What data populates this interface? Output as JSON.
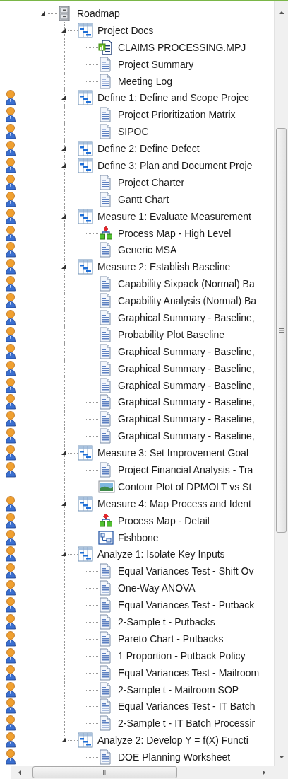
{
  "tree": {
    "label": "Roadmap",
    "kind": "cabinet",
    "assigned": false,
    "expanded": true,
    "children": [
      {
        "label": "Project Docs",
        "kind": "group",
        "assigned": false,
        "expanded": true,
        "children": [
          {
            "label": "CLAIMS PROCESSING.MPJ",
            "kind": "project",
            "assigned": false
          },
          {
            "label": "Project Summary",
            "kind": "document",
            "assigned": false
          },
          {
            "label": "Meeting Log",
            "kind": "document",
            "assigned": false
          }
        ]
      },
      {
        "label": "Define 1: Define and Scope Projec",
        "kind": "group",
        "assigned": true,
        "expanded": true,
        "children": [
          {
            "label": "Project Prioritization Matrix",
            "kind": "document",
            "assigned": true
          },
          {
            "label": "SIPOC",
            "kind": "document",
            "assigned": true
          }
        ]
      },
      {
        "label": "Define 2: Define Defect",
        "kind": "group",
        "assigned": true,
        "expanded": true
      },
      {
        "label": "Define 3: Plan and Document Proje",
        "kind": "group",
        "assigned": true,
        "expanded": true,
        "children": [
          {
            "label": "Project Charter",
            "kind": "document",
            "assigned": true
          },
          {
            "label": "Gantt Chart",
            "kind": "document",
            "assigned": true
          }
        ]
      },
      {
        "label": "Measure 1: Evaluate Measurement",
        "kind": "group",
        "assigned": true,
        "expanded": true,
        "children": [
          {
            "label": "Process Map - High Level",
            "kind": "process-map",
            "assigned": true
          },
          {
            "label": "Generic MSA",
            "kind": "document",
            "assigned": true
          }
        ]
      },
      {
        "label": "Measure 2: Establish Baseline",
        "kind": "group",
        "assigned": true,
        "expanded": true,
        "children": [
          {
            "label": "Capability Sixpack (Normal) Ba",
            "kind": "document",
            "assigned": true
          },
          {
            "label": "Capability Analysis (Normal) Ba",
            "kind": "document",
            "assigned": true
          },
          {
            "label": "Graphical Summary - Baseline,",
            "kind": "document",
            "assigned": true
          },
          {
            "label": "Probability Plot Baseline",
            "kind": "document",
            "assigned": true
          },
          {
            "label": "Graphical Summary - Baseline,",
            "kind": "document",
            "assigned": true
          },
          {
            "label": "Graphical Summary - Baseline,",
            "kind": "document",
            "assigned": true
          },
          {
            "label": "Graphical Summary - Baseline,",
            "kind": "document",
            "assigned": true
          },
          {
            "label": "Graphical Summary - Baseline,",
            "kind": "document",
            "assigned": true
          },
          {
            "label": "Graphical Summary - Baseline,",
            "kind": "document",
            "assigned": true
          },
          {
            "label": "Graphical Summary - Baseline,",
            "kind": "document",
            "assigned": true
          }
        ]
      },
      {
        "label": "Measure 3: Set Improvement Goal",
        "kind": "group",
        "assigned": true,
        "expanded": true,
        "children": [
          {
            "label": "Project Financial Analysis - Tra",
            "kind": "document",
            "assigned": true
          },
          {
            "label": "Contour Plot of DPMOLT vs St",
            "kind": "graph",
            "assigned": false
          }
        ]
      },
      {
        "label": "Measure 4: Map Process and Ident",
        "kind": "group",
        "assigned": true,
        "expanded": true,
        "children": [
          {
            "label": "Process Map - Detail",
            "kind": "process-map",
            "assigned": true
          },
          {
            "label": "Fishbone",
            "kind": "fishbone",
            "assigned": true
          }
        ]
      },
      {
        "label": "Analyze 1: Isolate Key Inputs",
        "kind": "group",
        "assigned": true,
        "expanded": true,
        "children": [
          {
            "label": "Equal Variances Test - Shift Ov",
            "kind": "document",
            "assigned": true
          },
          {
            "label": "One-Way ANOVA",
            "kind": "document",
            "assigned": true
          },
          {
            "label": "Equal Variances Test - Putback",
            "kind": "document",
            "assigned": true
          },
          {
            "label": "2-Sample t - Putbacks",
            "kind": "document",
            "assigned": true
          },
          {
            "label": "Pareto Chart - Putbacks",
            "kind": "document",
            "assigned": true
          },
          {
            "label": "1 Proportion - Putback Policy",
            "kind": "document",
            "assigned": true
          },
          {
            "label": "Equal Variances Test - Mailroom",
            "kind": "document",
            "assigned": true
          },
          {
            "label": "2-Sample t - Mailroom SOP",
            "kind": "document",
            "assigned": true
          },
          {
            "label": "Equal Variances Test - IT Batch",
            "kind": "document",
            "assigned": true
          },
          {
            "label": "2-Sample t - IT Batch Processir",
            "kind": "document",
            "assigned": true
          }
        ]
      },
      {
        "label": "Analyze 2: Develop Y = f(X) Functi",
        "kind": "group",
        "assigned": true,
        "expanded": true,
        "children": [
          {
            "label": "DOE Planning Worksheet",
            "kind": "document",
            "assigned": true
          }
        ]
      }
    ]
  }
}
